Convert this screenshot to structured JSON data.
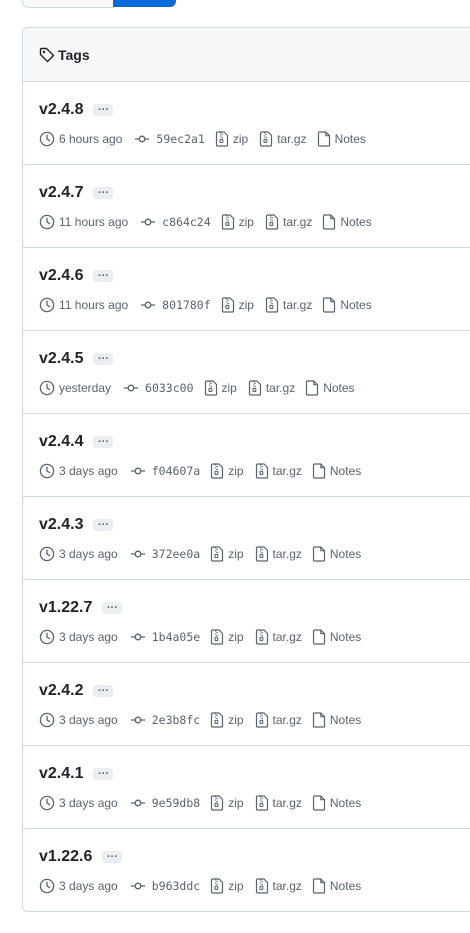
{
  "header": {
    "title": "Tags"
  },
  "labels": {
    "zip": "zip",
    "targz": "tar.gz",
    "notes": "Notes"
  },
  "tags": [
    {
      "name": "v2.4.8",
      "time": "6 hours ago",
      "sha": "59ec2a1"
    },
    {
      "name": "v2.4.7",
      "time": "11 hours ago",
      "sha": "c864c24"
    },
    {
      "name": "v2.4.6",
      "time": "11 hours ago",
      "sha": "801780f"
    },
    {
      "name": "v2.4.5",
      "time": "yesterday",
      "sha": "6033c00"
    },
    {
      "name": "v2.4.4",
      "time": "3 days ago",
      "sha": "f04607a"
    },
    {
      "name": "v2.4.3",
      "time": "3 days ago",
      "sha": "372ee0a"
    },
    {
      "name": "v1.22.7",
      "time": "3 days ago",
      "sha": "1b4a05e"
    },
    {
      "name": "v2.4.2",
      "time": "3 days ago",
      "sha": "2e3b8fc"
    },
    {
      "name": "v2.4.1",
      "time": "3 days ago",
      "sha": "9e59db8"
    },
    {
      "name": "v1.22.6",
      "time": "3 days ago",
      "sha": "b963ddc"
    }
  ],
  "icons": {
    "header": "tag-icon",
    "time": "clock-icon",
    "commit": "git-commit-icon",
    "zip": "file-zip-icon",
    "targz": "file-zip-icon",
    "notes": "file-icon",
    "more": "kebab-horizontal-icon"
  },
  "colors": {
    "accent": "#0969da",
    "muted": "#59636e",
    "border": "#d1d9e0"
  }
}
